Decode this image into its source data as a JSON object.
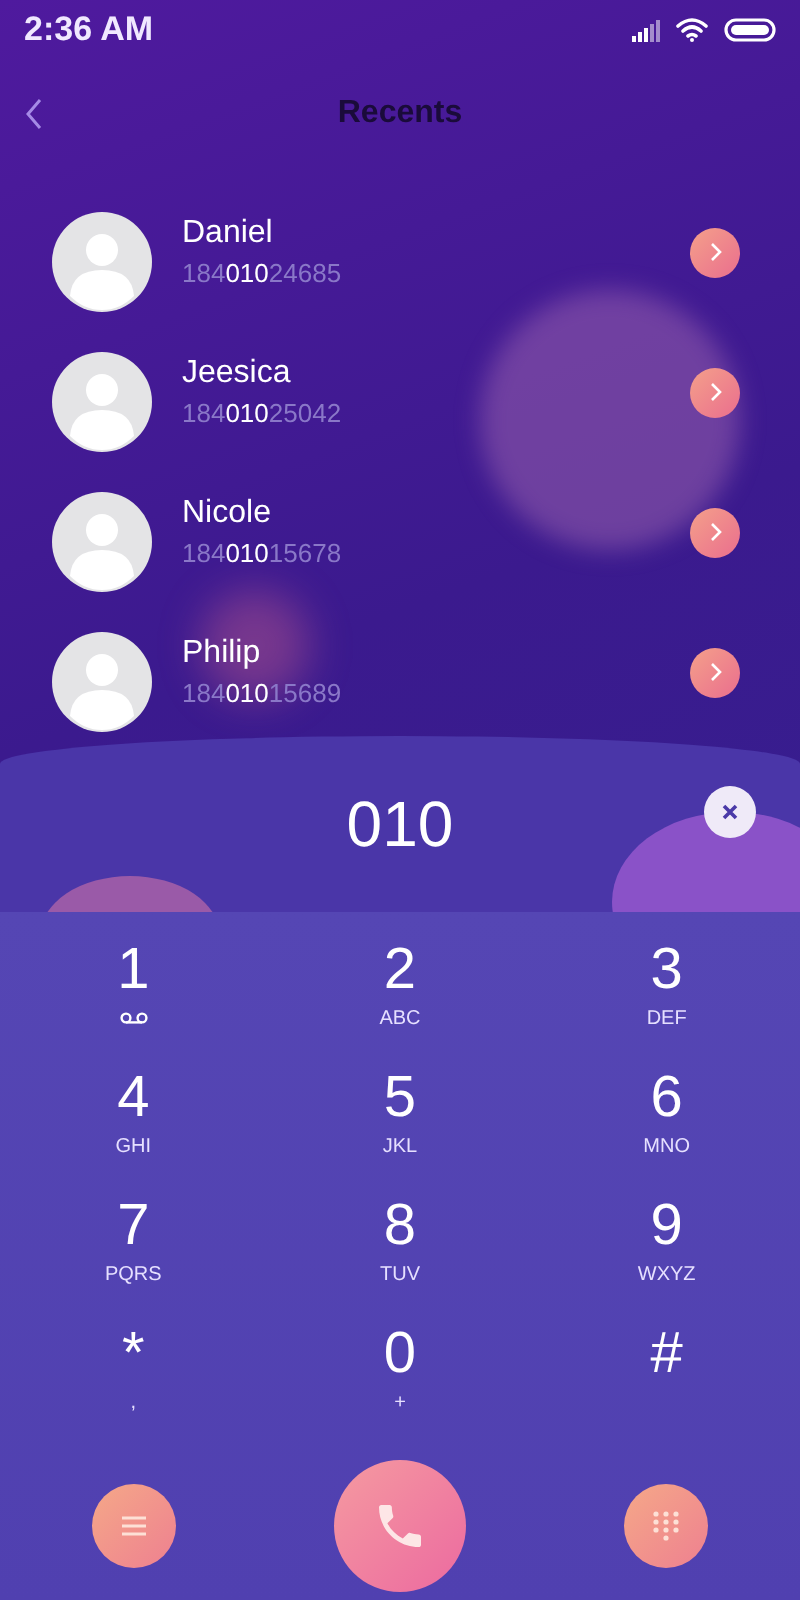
{
  "status_bar": {
    "time": "2:36 AM"
  },
  "header": {
    "title": "Recents"
  },
  "contacts": [
    {
      "name": "Daniel",
      "number": "184**010**24685"
    },
    {
      "name": "Jeesica",
      "number": "184**010**25042"
    },
    {
      "name": "Nicole",
      "number": "184**010**15678"
    },
    {
      "name": "Philip",
      "number": "184**010**15689"
    }
  ],
  "dialed": "010",
  "keys": [
    {
      "digit": "1",
      "kind": "voicemail"
    },
    {
      "digit": "2",
      "letters": "ABC",
      "kind": "text"
    },
    {
      "digit": "3",
      "letters": "DEF",
      "kind": "text"
    },
    {
      "digit": "4",
      "letters": "GHI",
      "kind": "text"
    },
    {
      "digit": "5",
      "letters": "JKL",
      "kind": "text"
    },
    {
      "digit": "6",
      "letters": "MNO",
      "kind": "text"
    },
    {
      "digit": "7",
      "letters": "PQRS",
      "kind": "text"
    },
    {
      "digit": "8",
      "letters": "TUV",
      "kind": "text"
    },
    {
      "digit": "9",
      "letters": "WXYZ",
      "kind": "text"
    },
    {
      "digit": "*",
      "letters": ",",
      "kind": "text"
    },
    {
      "digit": "0",
      "letters": "+",
      "kind": "text"
    },
    {
      "digit": "#",
      "kind": "text"
    }
  ]
}
